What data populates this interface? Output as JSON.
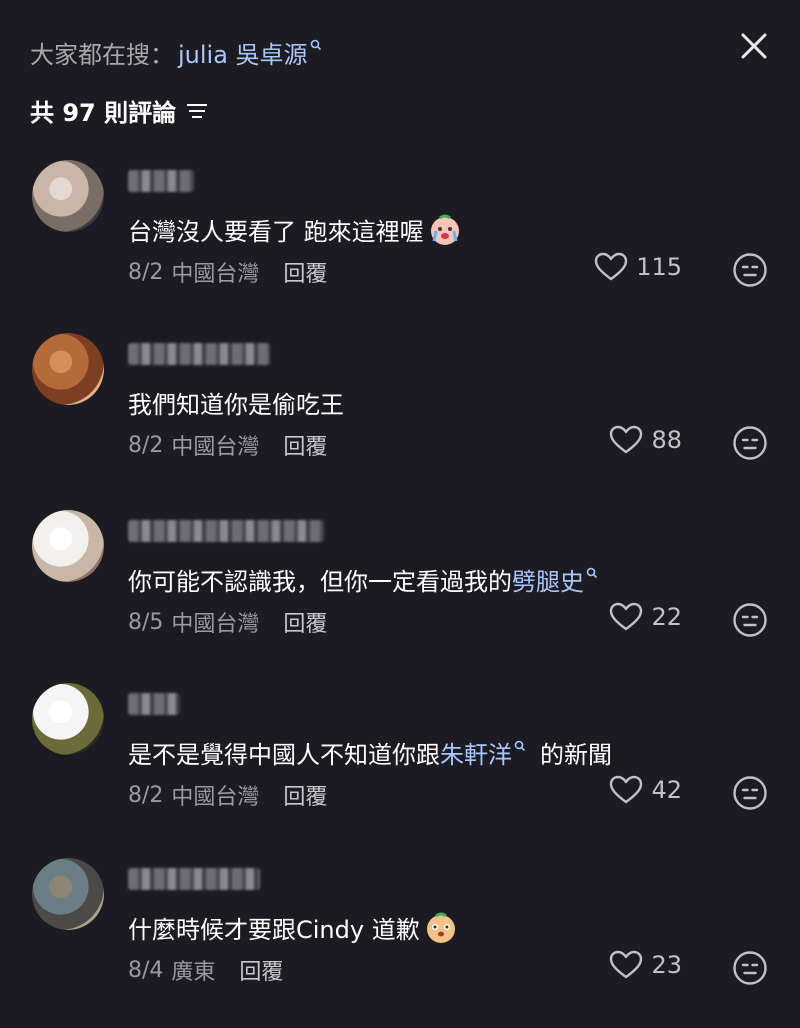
{
  "search": {
    "prefix": "大家都在搜：",
    "term": "julia 吳卓源"
  },
  "comment_count_label": "共 97 則評論",
  "comments": [
    {
      "avatar_colors": [
        "#c9b6a8",
        "#e4d9d0",
        "#7a6d66",
        "#3b3a3e"
      ],
      "text_parts": [
        "台灣沒人要看了 跑來這裡喔"
      ],
      "emoji": "crying-face-emoji",
      "date": "8/2",
      "location": "中國台灣",
      "reply_label": "回覆",
      "likes": "115"
    },
    {
      "avatar_colors": [
        "#b46a3a",
        "#d68f56",
        "#7d3f22",
        "#e0b48a"
      ],
      "text_parts": [
        "我們知道你是偷吃王"
      ],
      "emoji": null,
      "date": "8/2",
      "location": "中國台灣",
      "reply_label": "回覆",
      "likes": "88"
    },
    {
      "avatar_colors": [
        "#f3f1ee",
        "#ffffff",
        "#c8b7a6",
        "#8a7464"
      ],
      "text_parts": [
        "你可能不認識我，但你一定看過我的 ",
        "劈腿史"
      ],
      "emoji": null,
      "date": "8/5",
      "location": "中國台灣",
      "reply_label": "回覆",
      "likes": "22"
    },
    {
      "avatar_colors": [
        "#f5f5f5",
        "#ffffff",
        "#6b6b3a",
        "#2a2a24"
      ],
      "text_parts": [
        "是不是覺得中國人不知道你跟 ",
        "朱軒洋",
        " 的新聞"
      ],
      "emoji": null,
      "date": "8/2",
      "location": "中國台灣",
      "reply_label": "回覆",
      "likes": "42"
    },
    {
      "avatar_colors": [
        "#6b7e86",
        "#8d8574",
        "#4b4a47",
        "#a8a08d"
      ],
      "text_parts": [
        "什麼時候才要跟Cindy 道歉"
      ],
      "emoji": "smiling-face-emoji",
      "date": "8/4",
      "location": "廣東",
      "reply_label": "回覆",
      "likes": "23"
    }
  ]
}
